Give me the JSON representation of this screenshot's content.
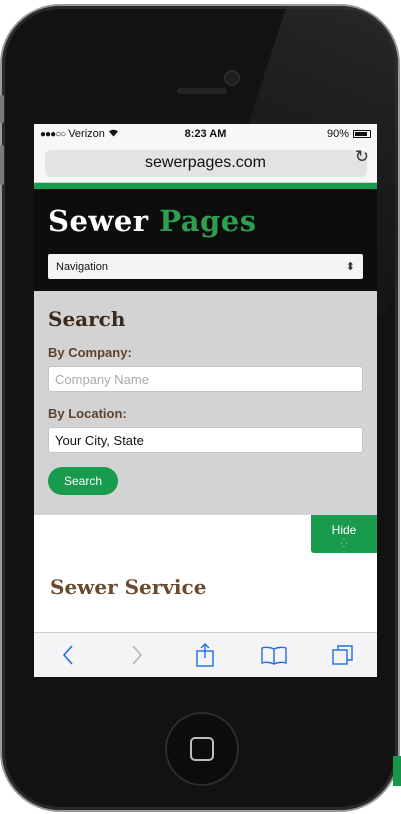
{
  "status": {
    "carrier": "Verizon",
    "time": "8:23 AM",
    "battery": "90%"
  },
  "browser": {
    "url": "sewerpages.com"
  },
  "site": {
    "logo_part1": "Sewer",
    "logo_part2": "Pages",
    "nav_select": "Navigation"
  },
  "search": {
    "title": "Search",
    "company_label": "By Company:",
    "company_placeholder": "Company Name",
    "location_label": "By Location:",
    "location_value": "Your City, State",
    "button": "Search"
  },
  "hide_button": "Hide",
  "section_title": "Sewer Service",
  "colors": {
    "brand_green": "#199b4d",
    "header_bg": "#0d0d0d",
    "search_bg": "#d3d3d3"
  },
  "icons": [
    "wifi-icon",
    "battery-icon",
    "reload-icon",
    "back-icon",
    "forward-icon",
    "share-icon",
    "bookmarks-icon",
    "tabs-icon",
    "select-arrows-icon"
  ]
}
